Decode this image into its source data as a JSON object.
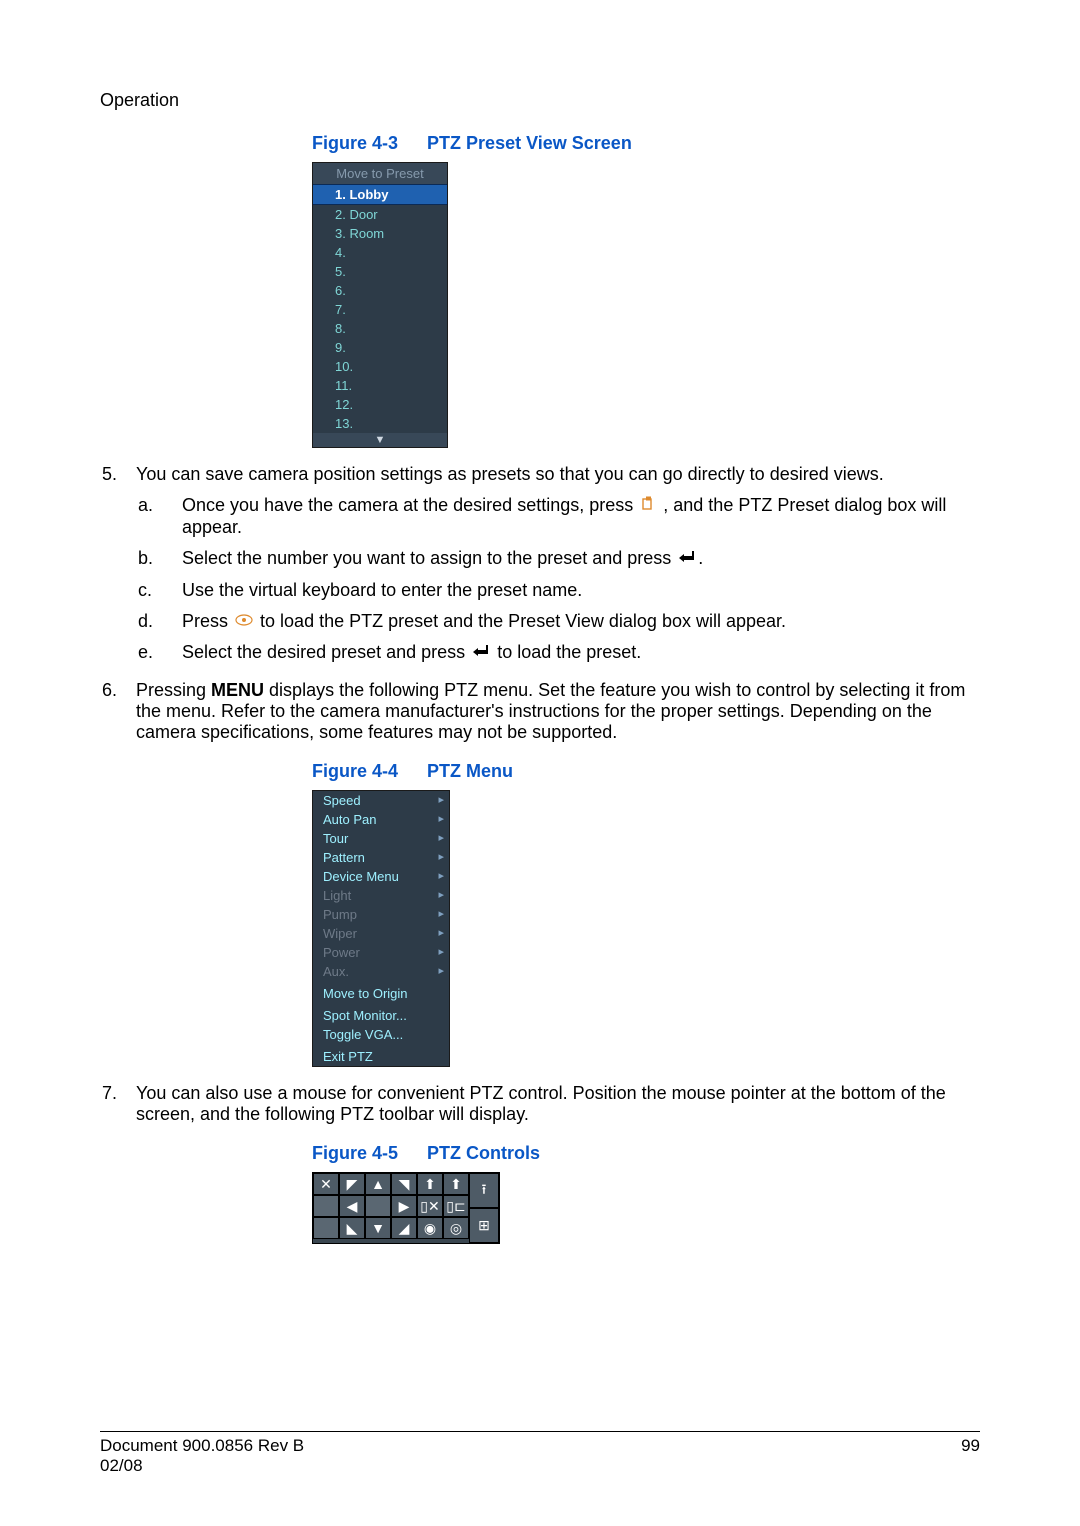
{
  "section_title": "Operation",
  "fig1": {
    "label": "Figure 4-3",
    "title": "PTZ Preset View Screen"
  },
  "preset": {
    "header": "Move to Preset",
    "items": [
      "1. Lobby",
      "2. Door",
      "3. Room",
      "4.",
      "5.",
      "6.",
      "7.",
      "8.",
      "9.",
      "10.",
      "11.",
      "12.",
      "13."
    ],
    "selected": 0
  },
  "step5": {
    "num": "5.",
    "text": "You can save camera position settings as presets so that you can go directly to desired views.",
    "a_num": "a.",
    "a_before": "Once you have the camera at the desired settings, press ",
    "a_after": ", and the PTZ Preset dialog box will appear.",
    "b_num": "b.",
    "b": "Select the number you want to assign to the preset and press ",
    "b_after": ".",
    "c_num": "c.",
    "c": "Use the virtual keyboard to enter the preset name.",
    "d_num": "d.",
    "d_before": "Press ",
    "d_after": " to load the PTZ preset and the Preset View dialog box will appear.",
    "e_num": "e.",
    "e_before": "Select the desired preset and press ",
    "e_after": " to load the preset."
  },
  "step6": {
    "num": "6.",
    "before": "Pressing ",
    "bold": "MENU",
    "after": " displays the following PTZ menu. Set the feature you wish to control by selecting it from the menu. Refer to the camera manufacturer's instructions for the proper settings. Depending on the camera specifications, some features may not be supported."
  },
  "fig2": {
    "label": "Figure 4-4",
    "title": "PTZ Menu"
  },
  "ptzmenu": {
    "active": [
      "Speed",
      "Auto Pan",
      "Tour",
      "Pattern",
      "Device Menu"
    ],
    "disabled": [
      "Light",
      "Pump",
      "Wiper",
      "Power",
      "Aux."
    ],
    "plain": [
      "Move to Origin",
      "Spot Monitor...",
      "Toggle VGA...",
      "Exit PTZ"
    ]
  },
  "step7": {
    "num": "7.",
    "text": "You can also use a mouse for convenient PTZ control. Position the mouse pointer at the bottom of the screen, and the following PTZ toolbar will display."
  },
  "fig3": {
    "label": "Figure 4-5",
    "title": "PTZ Controls"
  },
  "toolbar": {
    "r1": [
      "✕",
      "◤",
      "▲",
      "◥",
      "⬆",
      "⬆"
    ],
    "r1b": [
      "⭱"
    ],
    "r2": [
      "◀",
      "",
      "▶",
      "▯✕",
      "▯⊏"
    ],
    "r2b": [
      "⊞"
    ],
    "r3": [
      "◣",
      "▼",
      "◢",
      "◉",
      "◎"
    ]
  },
  "footer": {
    "doc": "Document 900.0856 Rev B",
    "date": "02/08",
    "page": "99"
  }
}
